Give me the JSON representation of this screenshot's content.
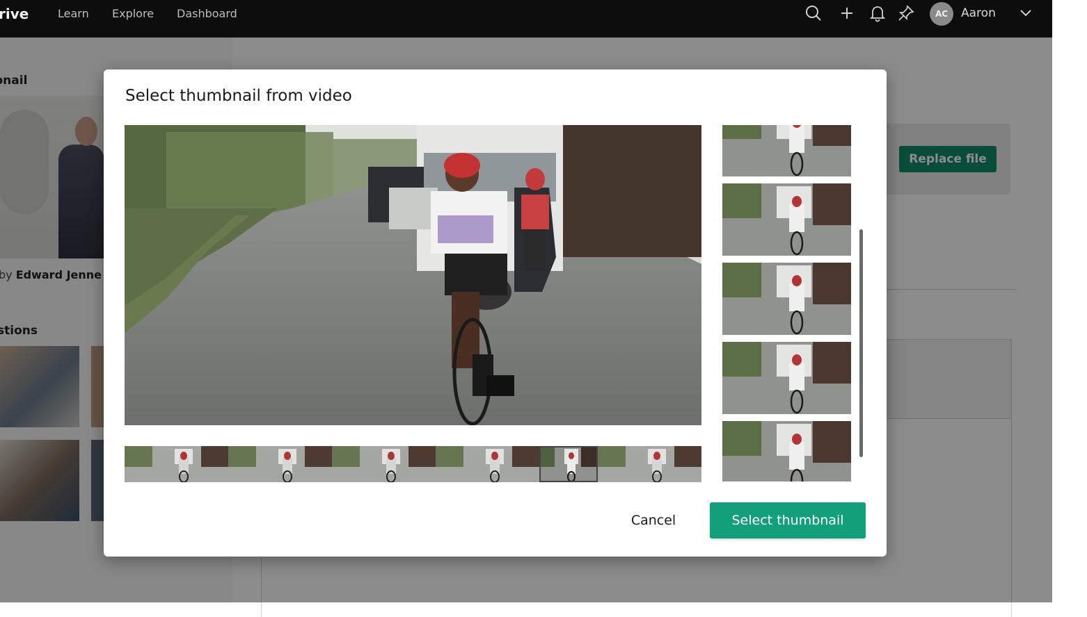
{
  "topbar": {
    "brand": "rive",
    "nav": [
      "Learn",
      "Explore",
      "Dashboard"
    ],
    "icons": [
      "search-icon",
      "plus-icon",
      "bell-icon",
      "pin-icon"
    ],
    "avatar_initials": "AC",
    "user_name": "Aaron",
    "user_menu_icon": "chevron-down-icon"
  },
  "background": {
    "thumbnail_heading": "bnail",
    "byline_prefix": "by",
    "byline_name": "Edward Jenne",
    "questions_heading": "stions",
    "replace_file_label": "Replace file"
  },
  "modal": {
    "title": "Select thumbnail from video",
    "cancel_label": "Cancel",
    "select_label": "Select thumbnail",
    "filmstrip_selected_index": 4,
    "accent_color": "#12a07a"
  }
}
